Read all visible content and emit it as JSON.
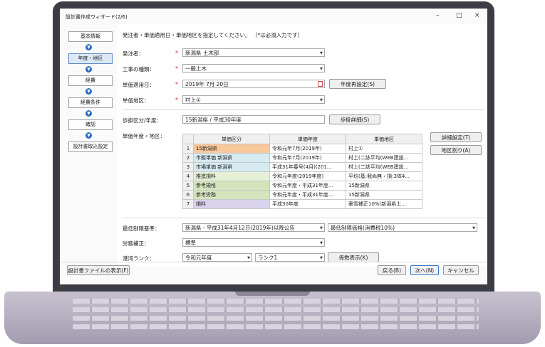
{
  "window": {
    "title": "設計書作成ウィザード(2/6)",
    "minimize": "–",
    "maximize": "□",
    "close": "×"
  },
  "sidebar": {
    "items": [
      {
        "label": "基本情報"
      },
      {
        "label": "年度・地区"
      },
      {
        "label": "経費"
      },
      {
        "label": "経費条件"
      },
      {
        "label": "確認"
      },
      {
        "label": "設計書取込設定"
      }
    ]
  },
  "intro": "発注者・単価適用日・単価地区を指定してください。 （*は必須入力です）",
  "form": {
    "orderer_label": "発注者：",
    "orderer_value": "新潟県 土木部",
    "work_type_label": "工事の種類：",
    "work_type_value": "一般土木",
    "price_date_label": "単価適用日：",
    "price_date_value": "2019年 7月 20日",
    "year_reset_button": "年度再設定(S)",
    "area_label": "単価地区：",
    "area_value": "村上①",
    "step_label": "歩掛区分/年度：",
    "step_value": "15新潟県 / 平成30年度",
    "step_detail_button": "歩掛詳細(S)",
    "price_year_area_label": "単価年度・地区：",
    "detail_setting_button": "詳細設定(T)",
    "area_split_button": "地区割り(A)",
    "min_limit_label": "最低制限基準：",
    "min_limit_value": "新潟県 - 平成31年4月12日(2019年)以降公告",
    "min_limit_value2": "最低制限価格(消費税10%)",
    "labor_label": "労務補正：",
    "labor_value": "標準",
    "port_label": "港湾ランク：",
    "port_year": "令和元年度",
    "port_rank": "ランク1",
    "coef_button": "係数表示(K)"
  },
  "table": {
    "headers": [
      "",
      "単価区分",
      "単価年度",
      "単価地区"
    ],
    "rows": [
      {
        "no": "1",
        "kubun": "15新潟県",
        "nendo": "令和元年7月(2019年)",
        "chiku": "村上①",
        "color": "#f9c89b"
      },
      {
        "no": "2",
        "kubun": "市販単価 新潟県",
        "nendo": "令和元年7月(2019年)",
        "chiku": "村上(二誌平均(WEB建設...",
        "color": "#d6ebf2"
      },
      {
        "no": "3",
        "kubun": "市場単価 新潟県",
        "nendo": "平成31年春号(4月)(201...",
        "chiku": "村上(二誌平均(WEB建設...",
        "color": "#d6ebf2"
      },
      {
        "no": "4",
        "kubun": "推進損料",
        "nendo": "令和元年度(2019年度)",
        "chiku": "平均(基:我ぬ無・損:3体4...",
        "color": "#e6f0d6"
      },
      {
        "no": "5",
        "kubun": "参考規格",
        "nendo": "令和元年度・平成31年度...",
        "chiku": "15新潟県",
        "color": "#d4e4bd"
      },
      {
        "no": "6",
        "kubun": "参考労務",
        "nendo": "令和元年度・平成31年度...",
        "chiku": "15新潟県",
        "color": "#d4e4bd"
      },
      {
        "no": "7",
        "kubun": "損料",
        "nendo": "平成30年度",
        "chiku": "豪雪補正10%(新潟県土...",
        "color": "#d9d2ec"
      }
    ]
  },
  "footer": {
    "show_file": "設計書ファイルの表示(F)",
    "back": "戻る(B)",
    "next": "次へ(N)",
    "cancel": "キャンセル"
  },
  "colors": {
    "accent": "#2b6fc2",
    "required": "#d22222"
  }
}
